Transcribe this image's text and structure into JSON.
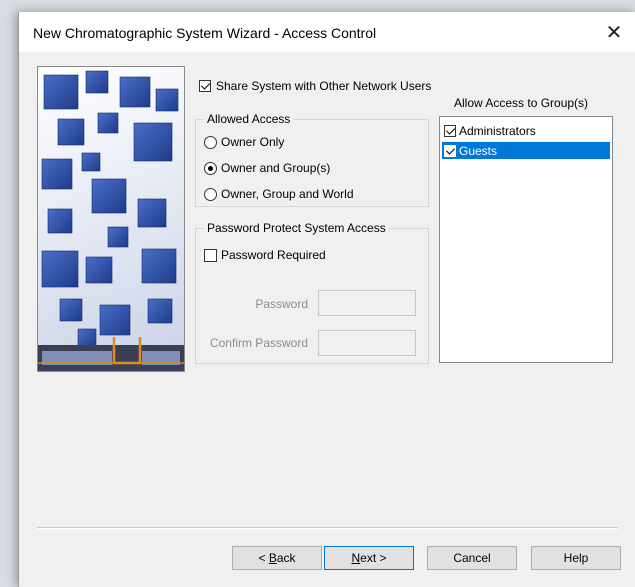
{
  "window": {
    "title": "New Chromatographic System Wizard - Access Control",
    "close_glyph": "✕"
  },
  "share": {
    "label": "Share System with Other Network Users",
    "checked": true
  },
  "allowed_access": {
    "title": "Allowed Access",
    "options": [
      {
        "label": "Owner Only",
        "selected": false
      },
      {
        "label": "Owner and Group(s)",
        "selected": true
      },
      {
        "label": "Owner, Group and World",
        "selected": false
      }
    ]
  },
  "password": {
    "title": "Password Protect System Access",
    "required_label": "Password Required",
    "required_checked": false,
    "password_label": "Password",
    "confirm_label": "Confirm Password",
    "password_value": "",
    "confirm_value": ""
  },
  "groups": {
    "caption": "Allow Access to Group(s)",
    "items": [
      {
        "label": "Administrators",
        "checked": true,
        "selected": false
      },
      {
        "label": "Guests",
        "checked": true,
        "selected": true
      }
    ]
  },
  "buttons": {
    "back": {
      "prefix": "< ",
      "mnemonic": "B",
      "rest": "ack"
    },
    "next": {
      "mnemonic": "N",
      "rest": "ext >"
    },
    "cancel": "Cancel",
    "help": "Help"
  },
  "colors": {
    "selection": "#0078d7",
    "image_blue": "#2b4fa8",
    "image_orange": "#e28a1a"
  },
  "icons": {
    "close": "close-icon",
    "wizard_image": "blue-cubes-banner"
  }
}
